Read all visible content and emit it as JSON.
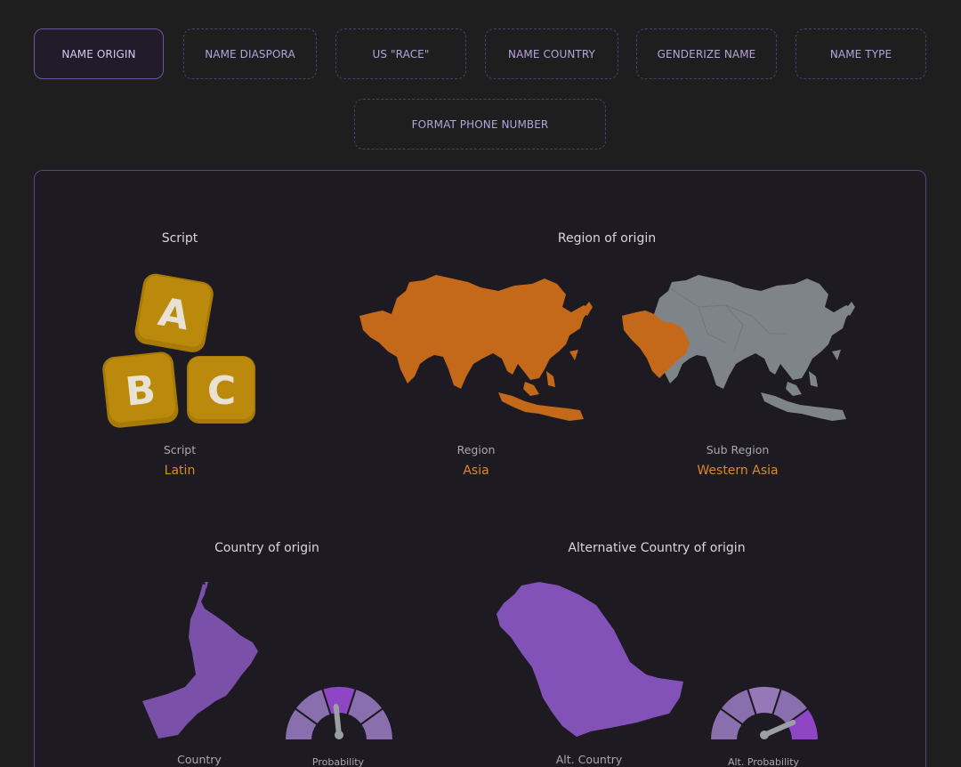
{
  "nav": {
    "items": [
      {
        "label": "NAME ORIGIN",
        "active": true
      },
      {
        "label": "NAME DIASPORA"
      },
      {
        "label": "US \"RACE\""
      },
      {
        "label": "NAME COUNTRY"
      },
      {
        "label": "GENDERIZE NAME"
      },
      {
        "label": "NAME TYPE"
      },
      {
        "label": "FORMAT PHONE NUMBER"
      }
    ]
  },
  "script_section": {
    "title": "Script",
    "blocks": [
      "A",
      "B",
      "C"
    ],
    "label": "Script",
    "value": "Latin"
  },
  "region_section": {
    "title": "Region of origin",
    "region_label": "Region",
    "region_value": "Asia",
    "subregion_label": "Sub Region",
    "subregion_value": "Western Asia"
  },
  "country_section": {
    "title": "Country of origin",
    "label": "Country",
    "gauge_label": "Probability"
  },
  "alt_country_section": {
    "title": "Alternative Country of origin",
    "label": "Alt. Country",
    "gauge_label": "Alt. Probability"
  },
  "colors": {
    "accent_orange": "#d98a2c",
    "map_orange": "#c4691a",
    "map_gray": "#7e8489",
    "accent_purple": "#8352b8",
    "block_gold": "#b8860b"
  },
  "icons": [
    "abc-blocks-icon",
    "asia-map-icon",
    "western-asia-map-icon",
    "oman-map-icon",
    "saudi-arabia-map-icon",
    "probability-gauge-icon"
  ]
}
